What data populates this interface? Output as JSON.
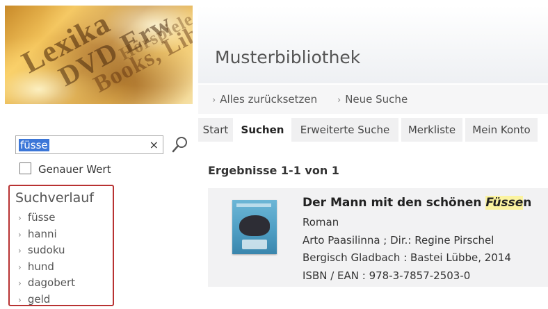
{
  "banner": {
    "words": [
      "Lexika",
      "DVD Erw",
      "Books, Libr",
      "Hörspiele"
    ]
  },
  "header": {
    "title": "Musterbibliothek"
  },
  "breadcrumbs": [
    {
      "label": "Alles zurücksetzen"
    },
    {
      "label": "Neue Suche"
    }
  ],
  "tabs": [
    {
      "label": "Start",
      "active": false
    },
    {
      "label": "Suchen",
      "active": true
    },
    {
      "label": "Erweiterte Suche",
      "active": false
    },
    {
      "label": "Merkliste",
      "active": false
    },
    {
      "label": "Mein Konto",
      "active": false
    }
  ],
  "search": {
    "value": "füsse",
    "clear_label": "×",
    "exact_label": "Genauer Wert",
    "exact_checked": false
  },
  "history": {
    "title": "Suchverlauf",
    "items": [
      "füsse",
      "hanni",
      "sudoku",
      "hund",
      "dagobert",
      "geld"
    ]
  },
  "results": {
    "heading": "Ergebnisse 1-1 von 1",
    "items": [
      {
        "title_prefix": "Der Mann mit den schönen ",
        "title_highlight": "Füsse",
        "title_suffix": "n",
        "subtitle": "Roman",
        "authors": "Arto Paasilinna ; Dir.: Regine Pirschel",
        "publisher": "Bergisch Gladbach : Bastei Lübbe, 2014",
        "isbn": "ISBN / EAN : 978-3-7857-2503-0"
      }
    ]
  },
  "colors": {
    "history_border": "#b83232",
    "highlight": "#fbf3a0",
    "selection": "#3b76d8"
  }
}
